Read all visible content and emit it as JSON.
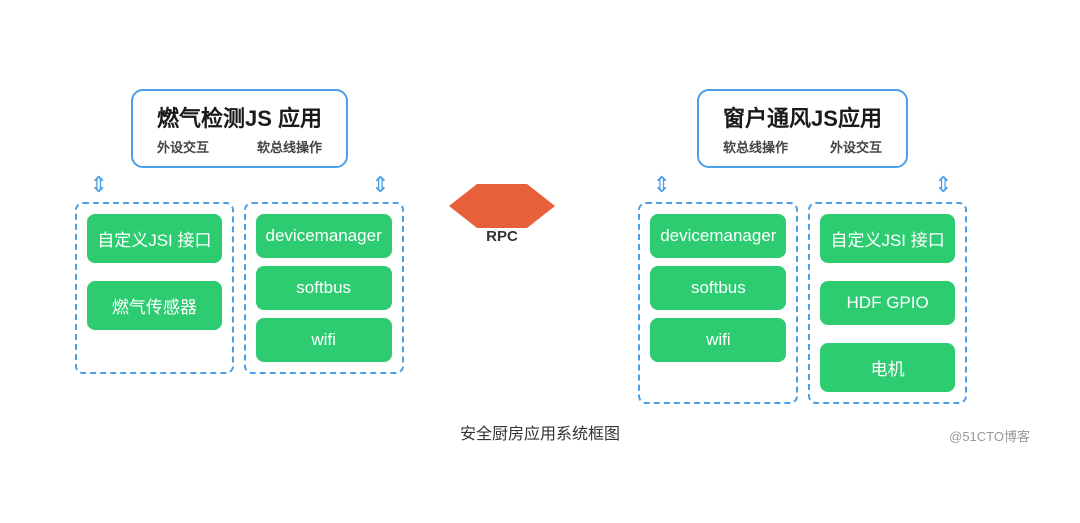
{
  "left_app": {
    "title": "燃气检测JS 应用",
    "label_left": "外设交互",
    "label_right": "软总线操作"
  },
  "right_app": {
    "title": "窗户通风JS应用",
    "label_left": "软总线操作",
    "label_right": "外设交互"
  },
  "left_stack": {
    "items": [
      "devicemanager",
      "softbus",
      "wifi"
    ]
  },
  "right_stack": {
    "items": [
      "devicemanager",
      "softbus",
      "wifi"
    ]
  },
  "left_devices": {
    "items": [
      "自定义JSI 接口",
      "燃气传感器"
    ]
  },
  "right_devices": {
    "items": [
      "自定义JSI 接口",
      "HDF GPIO",
      "电机"
    ]
  },
  "rpc": {
    "label": "RPC"
  },
  "caption": "安全厨房应用系统框图",
  "watermark": "@51CTO博客"
}
